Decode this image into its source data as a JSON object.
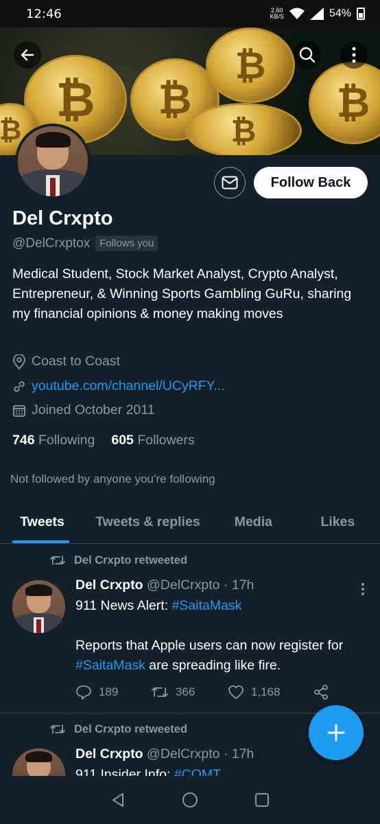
{
  "status_bar": {
    "time": "12:46",
    "net_speed_value": "2.60",
    "net_speed_unit": "KB/S",
    "battery": "54%"
  },
  "profile": {
    "name": "Del Crxpto",
    "handle": "@DelCrxptox",
    "follows_you": "Follows you",
    "follow_button": "Follow Back",
    "bio": "Medical Student, Stock Market Analyst, Crypto Analyst, Entrepreneur, & Winning Sports Gambling GuRu, sharing my financial opinions & money making moves",
    "location": "Coast to Coast",
    "website": "youtube.com/channel/UCyRFY...",
    "joined": "Joined October 2011",
    "following_count": "746",
    "following_label": "Following",
    "followers_count": "605",
    "followers_label": "Followers",
    "not_followed": "Not followed by anyone you’re following"
  },
  "tabs": [
    {
      "label": "Tweets",
      "active": true
    },
    {
      "label": "Tweets & replies",
      "active": false
    },
    {
      "label": "Media",
      "active": false
    },
    {
      "label": "Likes",
      "active": false
    }
  ],
  "tweets": [
    {
      "retweet_label": "Del Crxpto retweeted",
      "author": "Del Crxpto",
      "handle_time": "@DelCrxpto · 17h",
      "line1_prefix": "911 News Alert: ",
      "line1_hashtag": "#SaitaMask",
      "para2_prefix": "Reports that Apple users can now register for ",
      "para2_hashtag": "#SaitaMask",
      "para2_suffix": " are spreading like fire.",
      "replies": "189",
      "retweets": "366",
      "likes": "1,168"
    },
    {
      "retweet_label": "Del Crxpto retweeted",
      "author": "Del Crxpto",
      "handle_time": "@DelCrxpto · 17h",
      "line1_prefix": "911 Insider Info: ",
      "line1_hashtag": "#COMT"
    }
  ],
  "colors": {
    "background": "#15202b",
    "accent": "#1d9bf0",
    "secondary_text": "#8899a6",
    "divider": "#38444d"
  }
}
